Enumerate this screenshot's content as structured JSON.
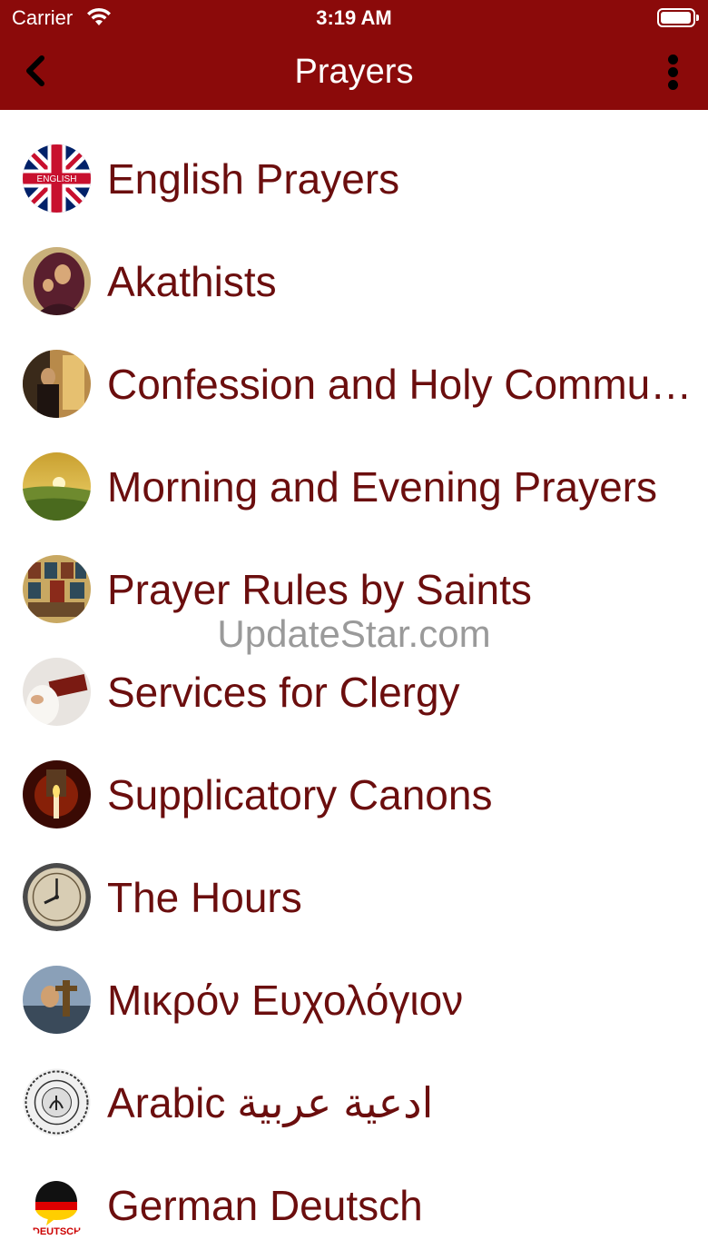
{
  "status_bar": {
    "carrier": "Carrier",
    "time": "3:19 AM"
  },
  "nav": {
    "title": "Prayers",
    "back_icon": "chevron-left-icon",
    "menu_icon": "more-vertical-icon"
  },
  "items": [
    {
      "label": "English Prayers",
      "thumb_text": "ENGLISH"
    },
    {
      "label": "Akathists"
    },
    {
      "label": "Confession and Holy Communion"
    },
    {
      "label": "Morning and Evening Prayers"
    },
    {
      "label": "Prayer Rules by Saints"
    },
    {
      "label": "Services for Clergy"
    },
    {
      "label": "Supplicatory Canons"
    },
    {
      "label": "The Hours"
    },
    {
      "label": "Μικρόν Ευχολόγιον"
    },
    {
      "label": "Arabic ادعية عربية"
    },
    {
      "label": "German Deutsch",
      "thumb_text": "DEUTSCH"
    }
  ],
  "watermark": "UpdateStar.com",
  "colors": {
    "header": "#8b0a0a",
    "label": "#6b0e0e"
  }
}
